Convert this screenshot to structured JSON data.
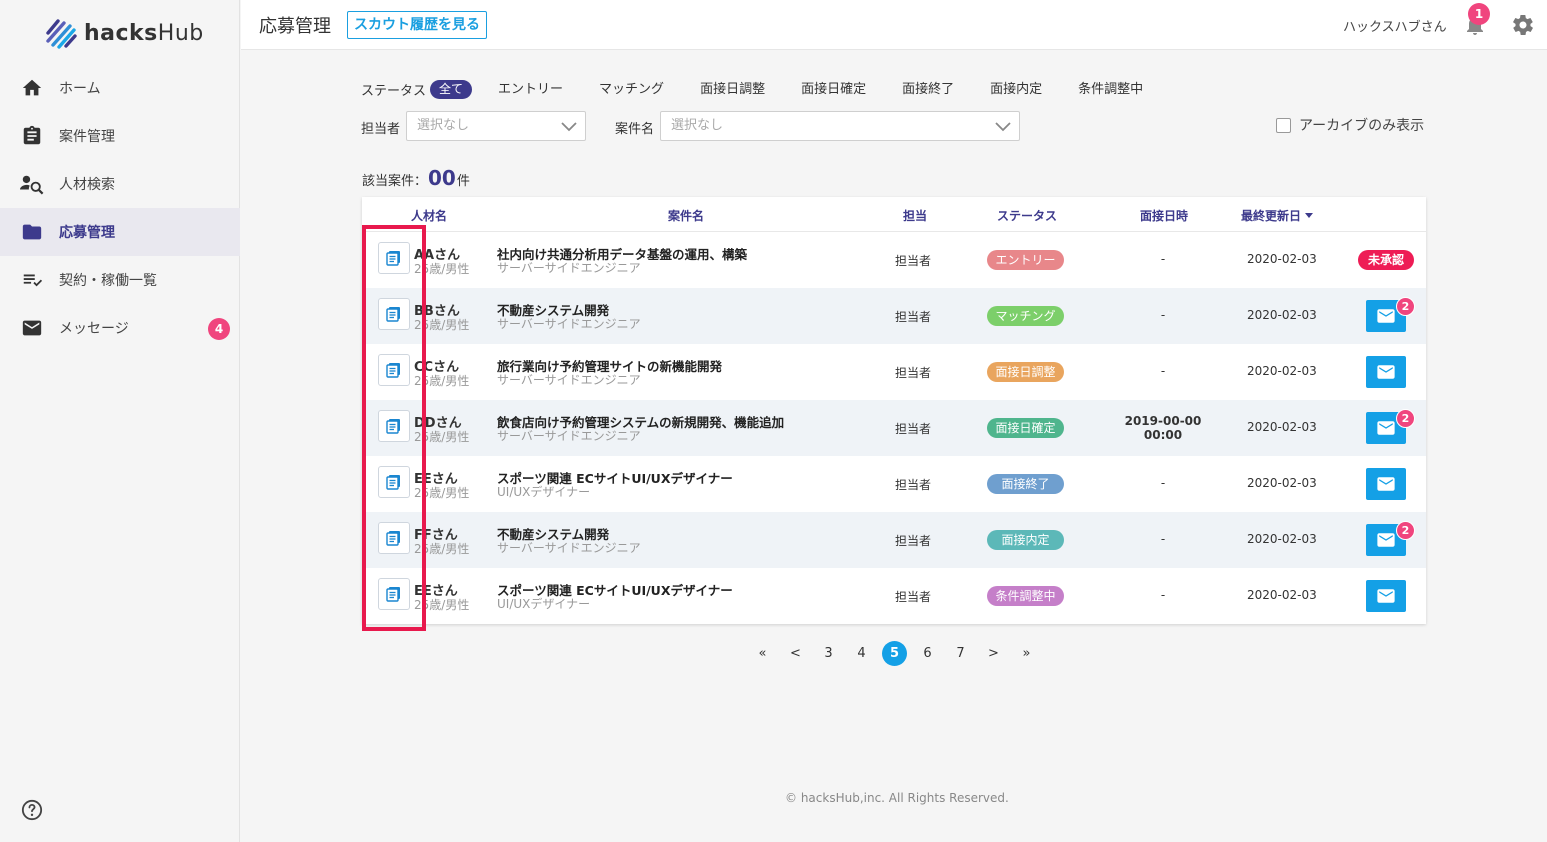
{
  "app": {
    "logo_text_bold": "hacks",
    "logo_text_rest": "Hub",
    "brand_color": "#3d3a8c",
    "accent_color": "#14a0e6"
  },
  "sidebar": {
    "items": [
      {
        "label": "ホーム",
        "icon": "home-icon"
      },
      {
        "label": "案件管理",
        "icon": "clipboard-icon"
      },
      {
        "label": "人材検索",
        "icon": "person-search-icon"
      },
      {
        "label": "応募管理",
        "icon": "folder-icon",
        "active": true
      },
      {
        "label": "契約・稼働一覧",
        "icon": "list-check-icon"
      },
      {
        "label": "メッセージ",
        "icon": "mail-icon",
        "badge": "4"
      }
    ],
    "help_icon": "help-icon"
  },
  "header": {
    "title": "応募管理",
    "scout_button": "スカウト履歴を見る",
    "user_name": "ハックスハブさん",
    "notification_count": "1"
  },
  "filters": {
    "status_label": "ステータス",
    "statuses": [
      "全て",
      "エントリー",
      "マッチング",
      "面接日調整",
      "面接日確定",
      "面接終了",
      "面接内定",
      "条件調整中"
    ],
    "owner_label": "担当者",
    "owner_placeholder": "選択なし",
    "project_label": "案件名",
    "project_placeholder": "選択なし",
    "archive_label": "アーカイブのみ表示"
  },
  "results": {
    "label": "該当案件：",
    "count": "00",
    "unit": "件"
  },
  "table": {
    "headers": {
      "person": "人材名",
      "project": "案件名",
      "owner": "担当",
      "status": "ステータス",
      "interview": "面接日時",
      "updated": "最終更新日"
    },
    "rows": [
      {
        "name": "AAさん",
        "meta": "25歳/男性",
        "title": "社内向け共通分析用データ基盤の運用、構築",
        "sub": "サーバーサイドエンジニア",
        "owner": "担当者",
        "status": "エントリー",
        "status_color": "#e8878a",
        "interview": "-",
        "updated": "2020-02-03",
        "action": "unapproved",
        "action_label": "未承認"
      },
      {
        "name": "BBさん",
        "meta": "25歳/男性",
        "title": "不動産システム開発",
        "sub": "サーバーサイドエンジニア",
        "owner": "担当者",
        "status": "マッチング",
        "status_color": "#7ccf6a",
        "interview": "-",
        "updated": "2020-02-03",
        "action": "mail",
        "mail_badge": "2"
      },
      {
        "name": "CCさん",
        "meta": "25歳/男性",
        "title": "旅行業向け予約管理サイトの新機能開発",
        "sub": "サーバーサイドエンジニア",
        "owner": "担当者",
        "status": "面接日調整",
        "status_color": "#e9a55e",
        "interview": "-",
        "updated": "2020-02-03",
        "action": "mail",
        "mail_badge": ""
      },
      {
        "name": "DDさん",
        "meta": "25歳/男性",
        "title": "飲食店向け予約管理システムの新規開発、機能追加",
        "sub": "サーバーサイドエンジニア",
        "owner": "担当者",
        "status": "面接日確定",
        "status_color": "#4fb58d",
        "interview_1": "2019-00-00",
        "interview_2": "00:00",
        "updated": "2020-02-03",
        "action": "mail",
        "mail_badge": "2"
      },
      {
        "name": "EEさん",
        "meta": "25歳/男性",
        "title": "スポーツ関連 ECサイトUI/UXデザイナー",
        "sub": "UI/UXデザイナー",
        "owner": "担当者",
        "status": "面接終了",
        "status_color": "#6f9fcf",
        "interview": "-",
        "updated": "2020-02-03",
        "action": "mail",
        "mail_badge": ""
      },
      {
        "name": "FFさん",
        "meta": "25歳/男性",
        "title": "不動産システム開発",
        "sub": "サーバーサイドエンジニア",
        "owner": "担当者",
        "status": "面接内定",
        "status_color": "#5cb8b8",
        "interview": "-",
        "updated": "2020-02-03",
        "action": "mail",
        "mail_badge": "2"
      },
      {
        "name": "EEさん",
        "meta": "25歳/男性",
        "title": "スポーツ関連 ECサイトUI/UXデザイナー",
        "sub": "UI/UXデザイナー",
        "owner": "担当者",
        "status": "条件調整中",
        "status_color": "#c57fc9",
        "interview": "-",
        "updated": "2020-02-03",
        "action": "mail",
        "mail_badge": ""
      }
    ]
  },
  "pagination": {
    "first": "«",
    "prev": "<",
    "pages": [
      "3",
      "4",
      "5",
      "6",
      "7"
    ],
    "current": "5",
    "next": ">",
    "last": "»"
  },
  "footer": {
    "copyright": "© hacksHub,inc. All Rights Reserved."
  }
}
